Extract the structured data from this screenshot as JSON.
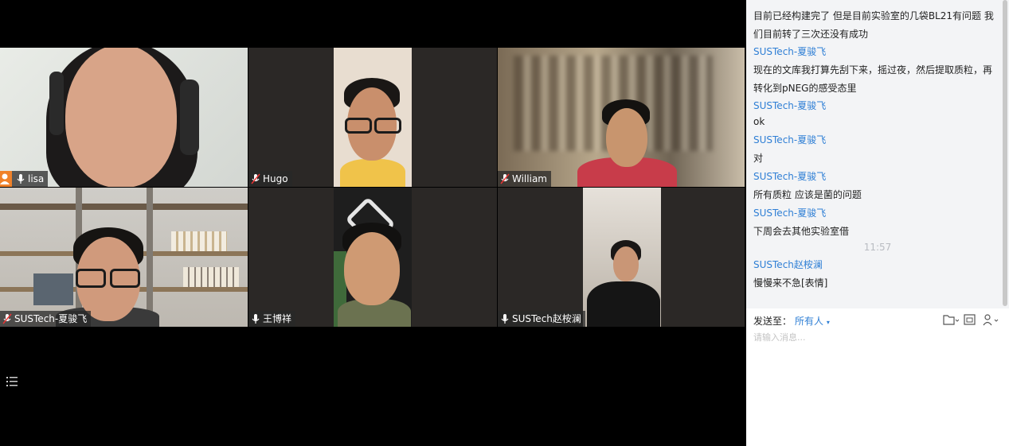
{
  "participants": [
    {
      "name": "lisa",
      "host": true
    },
    {
      "name": "Hugo"
    },
    {
      "name": "William"
    },
    {
      "name": "SUSTech-夏骏飞"
    },
    {
      "name": "王博祥"
    },
    {
      "name": "SUSTech赵桉澜"
    }
  ],
  "chat": {
    "lines": [
      {
        "text": "目前已经构建完了 但是目前实验室的几袋BL21有问题 我",
        "kind": "text"
      },
      {
        "text": "们目前转了三次还没有成功",
        "kind": "text"
      },
      {
        "text": "SUSTech-夏骏飞",
        "kind": "sender"
      },
      {
        "text": "现在的文库我打算先刮下来，摇过夜，然后提取质粒，再",
        "kind": "text"
      },
      {
        "text": "转化到pNEG的感受态里",
        "kind": "text"
      },
      {
        "text": "SUSTech-夏骏飞",
        "kind": "sender"
      },
      {
        "text": "ok",
        "kind": "text"
      },
      {
        "text": "SUSTech-夏骏飞",
        "kind": "sender"
      },
      {
        "text": "对",
        "kind": "text"
      },
      {
        "text": "SUSTech-夏骏飞",
        "kind": "sender"
      },
      {
        "text": "所有质粒 应该是菌的问题",
        "kind": "text"
      },
      {
        "text": "SUSTech-夏骏飞",
        "kind": "sender"
      },
      {
        "text": "下周会去其他实验室借",
        "kind": "text"
      },
      {
        "text": "11:57",
        "kind": "time"
      },
      {
        "text": "SUSTech赵桉澜",
        "kind": "sender"
      },
      {
        "text": "慢慢来不急[表情]",
        "kind": "text"
      }
    ],
    "send_to_label": "发送至：",
    "recipient": "所有人",
    "input_placeholder": "请输入消息..."
  },
  "colors": {
    "sender": "#2f7fd5",
    "host_badge": "#f0822a",
    "chat_bg": "#f3f4f6"
  },
  "icons": [
    "list-icon",
    "mic-icon",
    "mic-muted-icon",
    "host-icon",
    "file-icon",
    "screenshot-icon",
    "user-icon",
    "chevron-down-icon"
  ]
}
